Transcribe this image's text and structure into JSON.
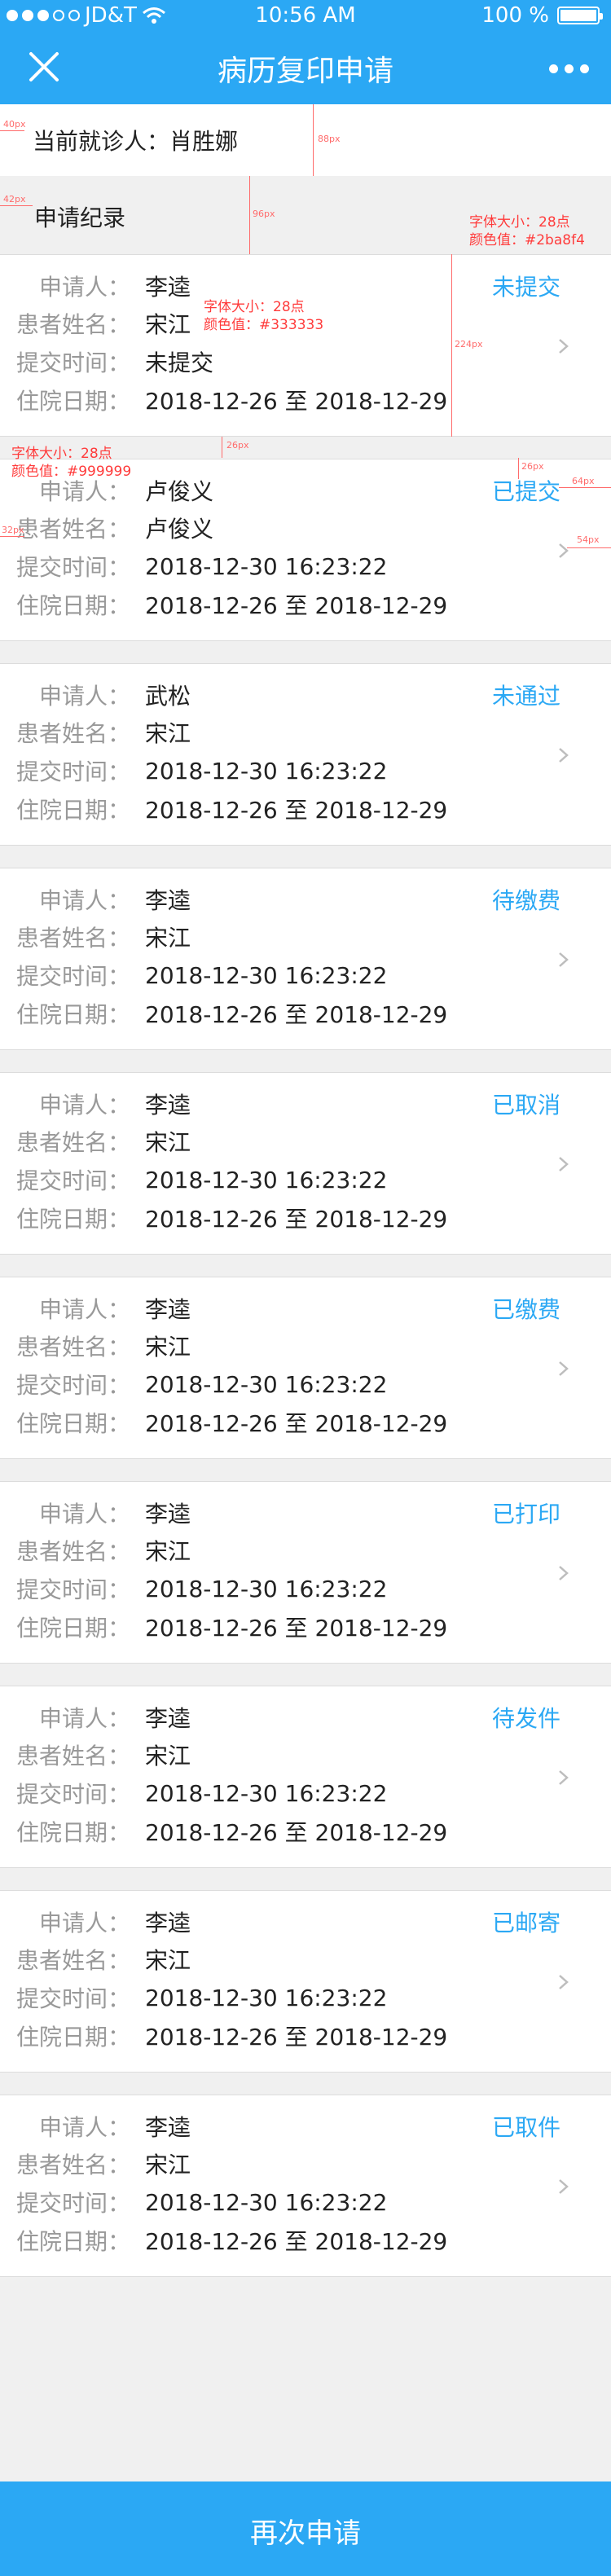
{
  "status_bar": {
    "carrier": "JD&T",
    "time": "10:56 AM",
    "battery": "100 %"
  },
  "nav": {
    "title": "病历复印申请",
    "close_icon": "close-icon",
    "more_icon": "more-icon"
  },
  "current_patient": "当前就诊人：肖胜娜",
  "section_title": "申请纪录",
  "labels": {
    "applicant": "申请人：",
    "patient": "患者姓名：",
    "submit_time": "提交时间：",
    "hospital_dates": "住院日期："
  },
  "records": [
    {
      "applicant": "李逵",
      "patient": "宋江",
      "submit_time": "未提交",
      "hospital_dates": "2018-12-26 至 2018-12-29",
      "status": "未提交"
    },
    {
      "applicant": "卢俊义",
      "patient": "卢俊义",
      "submit_time": "2018-12-30 16:23:22",
      "hospital_dates": "2018-12-26 至 2018-12-29",
      "status": "已提交"
    },
    {
      "applicant": "武松",
      "patient": "宋江",
      "submit_time": "2018-12-30 16:23:22",
      "hospital_dates": "2018-12-26 至 2018-12-29",
      "status": "未通过"
    },
    {
      "applicant": "李逵",
      "patient": "宋江",
      "submit_time": "2018-12-30 16:23:22",
      "hospital_dates": "2018-12-26 至 2018-12-29",
      "status": "待缴费"
    },
    {
      "applicant": "李逵",
      "patient": "宋江",
      "submit_time": "2018-12-30 16:23:22",
      "hospital_dates": "2018-12-26 至 2018-12-29",
      "status": "已取消"
    },
    {
      "applicant": "李逵",
      "patient": "宋江",
      "submit_time": "2018-12-30 16:23:22",
      "hospital_dates": "2018-12-26 至 2018-12-29",
      "status": "已缴费"
    },
    {
      "applicant": "李逵",
      "patient": "宋江",
      "submit_time": "2018-12-30 16:23:22",
      "hospital_dates": "2018-12-26 至 2018-12-29",
      "status": "已打印"
    },
    {
      "applicant": "李逵",
      "patient": "宋江",
      "submit_time": "2018-12-30 16:23:22",
      "hospital_dates": "2018-12-26 至 2018-12-29",
      "status": "待发件"
    },
    {
      "applicant": "李逵",
      "patient": "宋江",
      "submit_time": "2018-12-30 16:23:22",
      "hospital_dates": "2018-12-26 至 2018-12-29",
      "status": "已邮寄"
    },
    {
      "applicant": "李逵",
      "patient": "宋江",
      "submit_time": "2018-12-30 16:23:22",
      "hospital_dates": "2018-12-26 至 2018-12-29",
      "status": "已取件"
    }
  ],
  "annotations": {
    "status_font": "字体大小：28点",
    "status_color": "颜色值：#2ba8f4",
    "value_font": "字体大小：28点",
    "value_color": "颜色值：#333333",
    "label_font": "字体大小：28点",
    "label_color": "颜色值：#999999",
    "m40": "40px",
    "m88": "88px",
    "m42": "42px",
    "m96": "96px",
    "m224": "224px",
    "m26": "26px",
    "m26b": "26px",
    "m64": "64px",
    "m32": "32px",
    "m54": "54px",
    "m116": "116px"
  },
  "bottom_button": "再次申请",
  "colors": {
    "accent": "#2ba8f4",
    "value_text": "#333333",
    "label_text": "#999999",
    "background": "#f0f0f0"
  }
}
